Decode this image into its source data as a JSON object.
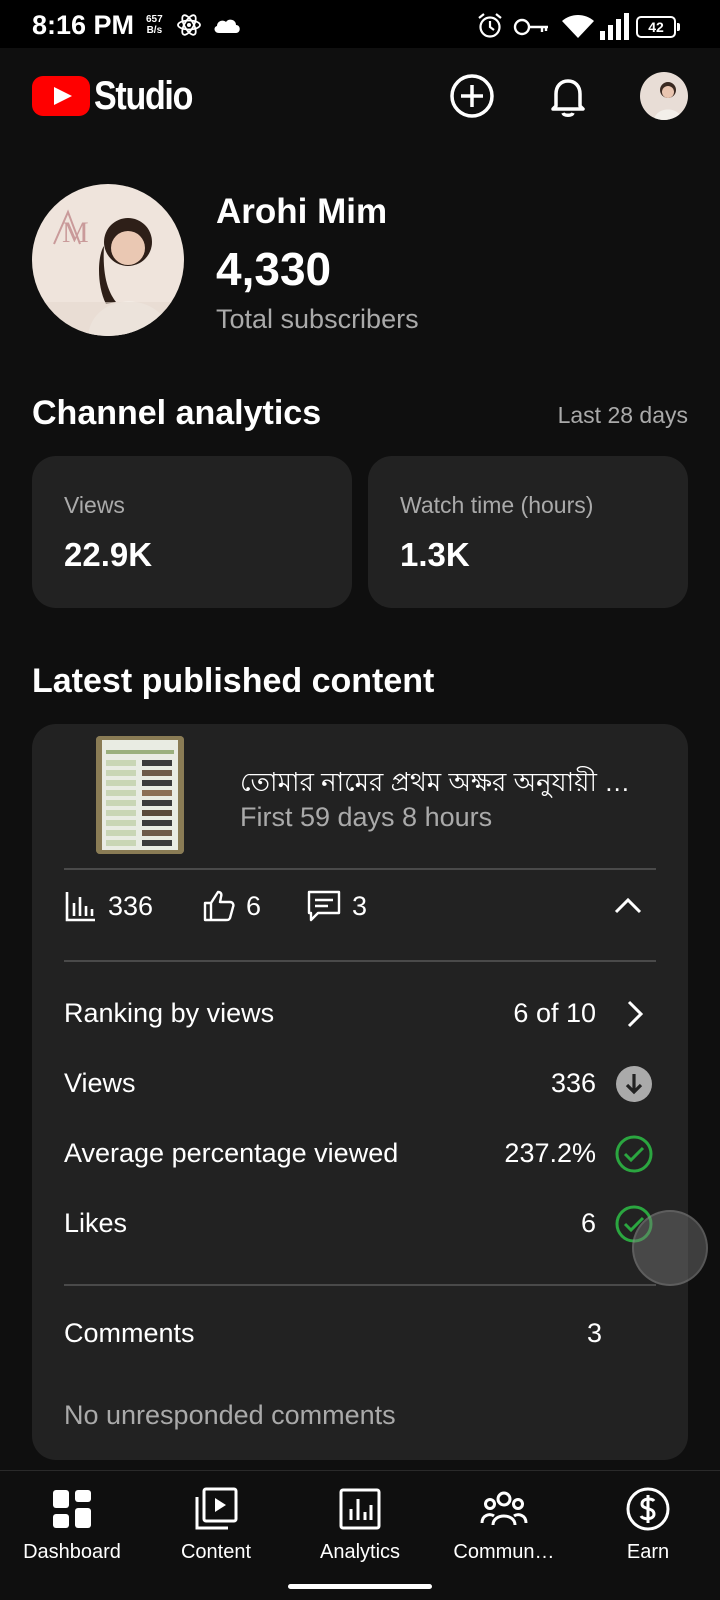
{
  "status_bar": {
    "time": "8:16 PM",
    "net_speed_value": "657",
    "net_speed_unit": "B/s",
    "battery": "42",
    "icons": [
      "atom-icon",
      "cloud-icon",
      "alarm-icon",
      "key-icon",
      "wifi-icon",
      "signal-icon",
      "battery-icon"
    ]
  },
  "header": {
    "brand": "Studio",
    "icons": [
      "youtube-play-icon",
      "create-plus-icon",
      "bell-icon",
      "account-avatar"
    ]
  },
  "profile": {
    "channel_name": "Arohi Mim",
    "subscribers": "4,330",
    "subscribers_label": "Total subscribers"
  },
  "analytics": {
    "title": "Channel analytics",
    "period": "Last 28 days",
    "cards": [
      {
        "label": "Views",
        "value": "22.9K"
      },
      {
        "label": "Watch time (hours)",
        "value": "1.3K"
      }
    ]
  },
  "latest": {
    "title": "Latest published content",
    "video_title": "তোমার নামের প্রথম অক্ষর অনুযায়ী …",
    "video_age": "First 59 days 8 hours",
    "views": "336",
    "likes": "6",
    "comments": "3",
    "metrics": [
      {
        "label": "Ranking by views",
        "value": "6 of 10",
        "icon": "chevron-right-icon"
      },
      {
        "label": "Views",
        "value": "336",
        "icon": "arrow-down-circle-icon"
      },
      {
        "label": "Average percentage viewed",
        "value": "237.2%",
        "icon": "check-circle-icon"
      },
      {
        "label": "Likes",
        "value": "6",
        "icon": "check-circle-icon"
      }
    ],
    "comments_label": "Comments",
    "comments_value": "3",
    "no_responded": "No unresponded comments"
  },
  "nav": {
    "items": [
      {
        "label": "Dashboard",
        "icon": "dashboard-icon"
      },
      {
        "label": "Content",
        "icon": "content-icon"
      },
      {
        "label": "Analytics",
        "icon": "analytics-icon"
      },
      {
        "label": "Commun…",
        "icon": "community-icon"
      },
      {
        "label": "Earn",
        "icon": "earn-icon"
      }
    ]
  },
  "colors": {
    "background": "#0f0f0f",
    "card": "#222222",
    "brand_red": "#ff0000",
    "positive_green": "#2ba640",
    "muted_text": "#aaaaaa"
  }
}
